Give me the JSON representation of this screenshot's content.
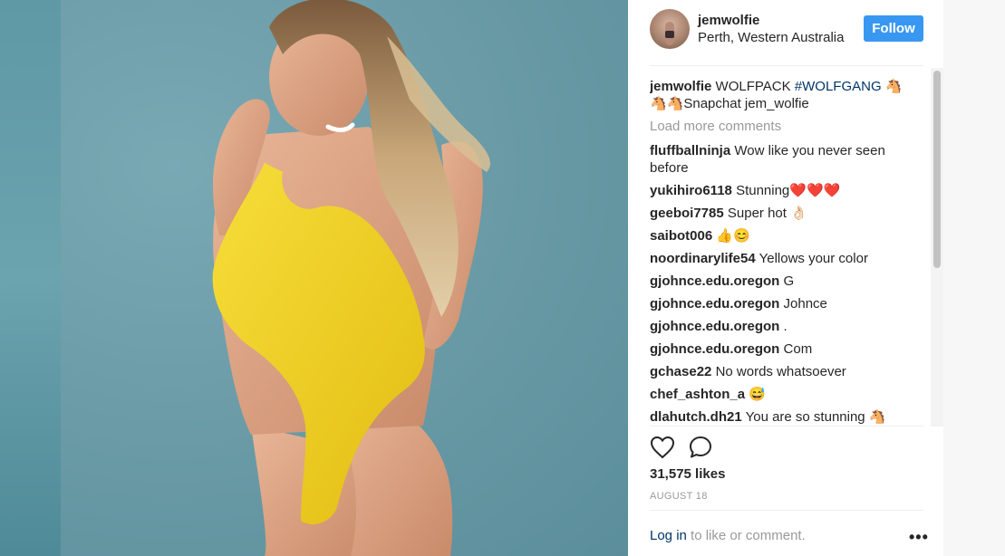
{
  "post": {
    "username": "jemwolfie",
    "location": "Perth, Western Australia",
    "follow_label": "Follow",
    "caption": {
      "user": "jemwolfie",
      "text_before": "WOLFPACK",
      "hashtag": "#WOLFGANG",
      "emoji_1": "🐴",
      "emoji_2": "🐴🐴",
      "text_after": "Snapchat jem_wolfie"
    },
    "load_more_label": "Load more comments",
    "comments": [
      {
        "user": "fluffballninja",
        "text": "Wow like you never seen before"
      },
      {
        "user": "yukihiro6118",
        "text": "Stunning❤️❤️❤️"
      },
      {
        "user": "geeboi7785",
        "text": "Super hot 👌🏻"
      },
      {
        "user": "saibot006",
        "text": "👍😊"
      },
      {
        "user": "noordinarylife54",
        "text": "Yellows your color"
      },
      {
        "user": "gjohnce.edu.oregon",
        "text": "G"
      },
      {
        "user": "gjohnce.edu.oregon",
        "text": "Johnce"
      },
      {
        "user": "gjohnce.edu.oregon",
        "text": "."
      },
      {
        "user": "gjohnce.edu.oregon",
        "text": "Com"
      },
      {
        "user": "gchase22",
        "text": "No words whatsoever"
      },
      {
        "user": "chef_ashton_a",
        "text": "😅"
      },
      {
        "user": "dlahutch.dh21",
        "text": "You are so stunning 🐴"
      }
    ],
    "likes": "31,575 likes",
    "date": "AUGUST 18",
    "footer": {
      "login_link": "Log in",
      "login_rest": " to like or comment.",
      "more": "•••"
    }
  },
  "colors": {
    "accent": "#3897f0",
    "link": "#003569",
    "muted": "#999999",
    "swimsuit": "#f2d024"
  },
  "icons": [
    "heart-icon",
    "comment-icon",
    "more-options-icon"
  ]
}
